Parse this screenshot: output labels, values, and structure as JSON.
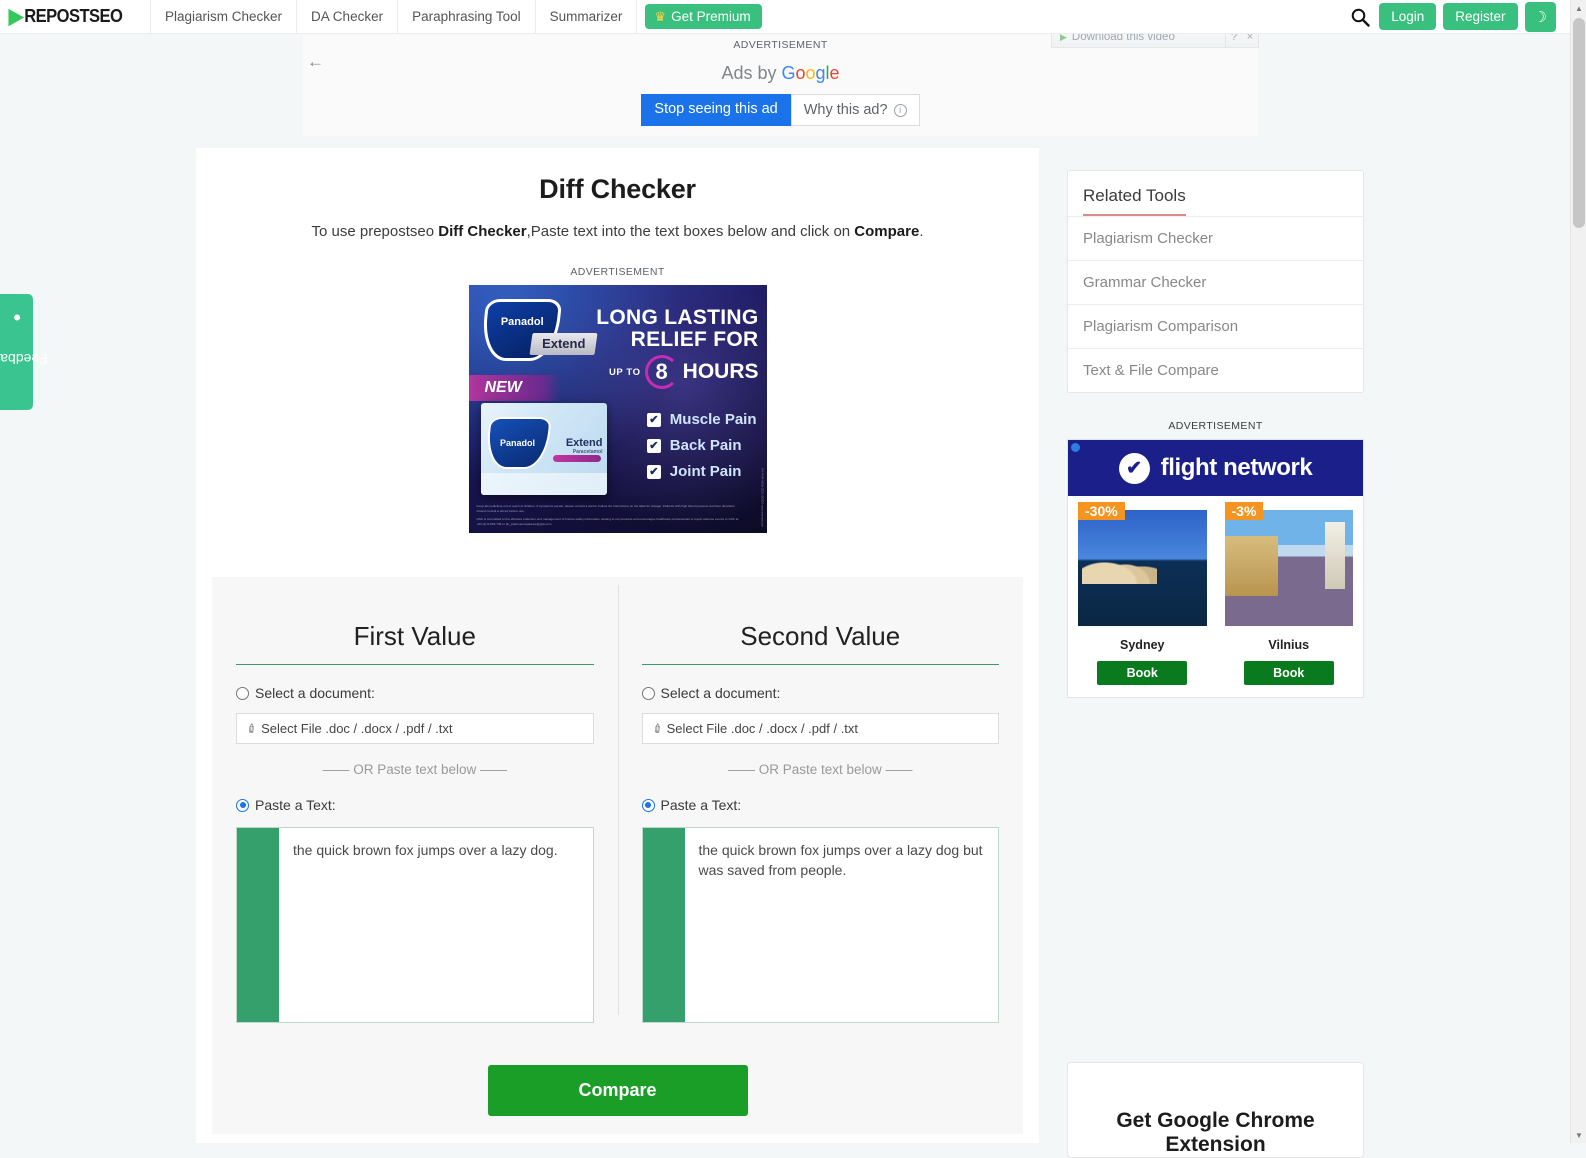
{
  "header": {
    "logo_mark": "▶",
    "logo_text": "REPOSTSEO",
    "nav": [
      {
        "label": "Plagiarism Checker"
      },
      {
        "label": "DA Checker"
      },
      {
        "label": "Paraphrasing Tool"
      },
      {
        "label": "Summarizer"
      }
    ],
    "premium": {
      "label": "Get Premium",
      "icon": "crown-icon",
      "glyph": "♛"
    },
    "search_icon": "search-icon",
    "login_label": "Login",
    "register_label": "Register",
    "theme_toggle_glyph": "☽",
    "theme_toggle_name": "dark-mode-toggle",
    "accent_green": "#3ac07e"
  },
  "download_overlay": {
    "label": "Download this video",
    "play_glyph": "▶",
    "help_label": "?",
    "close_label": "×"
  },
  "feedback": {
    "label": "Feedback",
    "bubble_glyph": "●"
  },
  "top_ad": {
    "label": "ADVERTISEMENT",
    "back_glyph": "←",
    "ads_by_prefix": "Ads by",
    "ads_by_brand": "Google",
    "stop_label": "Stop seeing this ad",
    "why_label": "Why this ad?",
    "info_glyph": "i",
    "stop_color": "#1a73e8"
  },
  "main": {
    "title": "Diff Checker",
    "subtitle_parts": {
      "p1": "To use prepostseo ",
      "b1": "Diff Checker",
      "p2": ",Paste text into the text boxes below and click on ",
      "b2": "Compare",
      "p3": "."
    },
    "ad_label": "ADVERTISEMENT",
    "compare_button": "Compare"
  },
  "panadol_ad": {
    "brand": "Panadol",
    "sub_brand": "Extend",
    "new_tag": "NEW",
    "headline_line1": "LONG LASTING",
    "headline_line2": "RELIEF FOR",
    "up_to": "UP TO",
    "hours_number": "8",
    "hours_word": "HOURS",
    "benefits": [
      "Muscle Pain",
      "Back Pain",
      "Joint Pain"
    ],
    "check_glyph": "✔",
    "box_brand": "Panadol",
    "box_sub": "Extend",
    "box_generic": "Paracetamol",
    "fineprint_1": "Keep all medicines out of reach of children. If symptoms persist, please consult a doctor. Follow the instructions on the label for dosage. Patients with high blood pressure and liver disorders should consult a doctor before use.",
    "fineprint_2": "GSK is committed to the effective collection and management of human safety information relating to our products and encourages healthcare professionals to report adverse events to GSK at +63 (2) 8-639-738 or ph_pharmacovigilance@gsk.com",
    "sidetext": "PH-PAN-WEB-2021-00004  www.panadol.ph"
  },
  "compare": {
    "columns": [
      {
        "title": "First Value",
        "select_doc_label": "Select a document:",
        "file_button_label": "Select File .doc / .docx / .pdf / .txt",
        "or_divider": "—— OR Paste text below ——",
        "paste_label": "Paste a Text:",
        "select_doc_checked": false,
        "paste_checked": true,
        "text_value": "the quick brown fox jumps over a lazy dog."
      },
      {
        "title": "Second Value",
        "select_doc_label": "Select a document:",
        "file_button_label": "Select File .doc / .docx / .pdf / .txt",
        "or_divider": "—— OR Paste text below ——",
        "paste_label": "Paste a Text:",
        "select_doc_checked": false,
        "paste_checked": true,
        "text_value": "the quick brown fox jumps over a lazy dog but was saved from people."
      }
    ],
    "clip_glyph": "✐"
  },
  "sidebar": {
    "related_tools_title": "Related Tools",
    "related_tools": [
      {
        "label": "Plagiarism Checker"
      },
      {
        "label": "Grammar Checker"
      },
      {
        "label": "Plagiarism Comparison"
      },
      {
        "label": "Text & File Compare"
      }
    ],
    "ad_label": "ADVERTISEMENT",
    "flight_ad": {
      "brand": "flight network",
      "check_glyph": "✔",
      "offers": [
        {
          "discount": "-30%",
          "city": "Sydney",
          "book_label": "Book"
        },
        {
          "discount": "-3%",
          "city": "Vilnius",
          "book_label": "Book"
        }
      ]
    },
    "chrome_card": {
      "title_line1": "Get Google Chrome",
      "title_line2": "Extension"
    }
  },
  "scrollbar": {
    "up_glyph": "▲",
    "down_glyph": "▼"
  }
}
